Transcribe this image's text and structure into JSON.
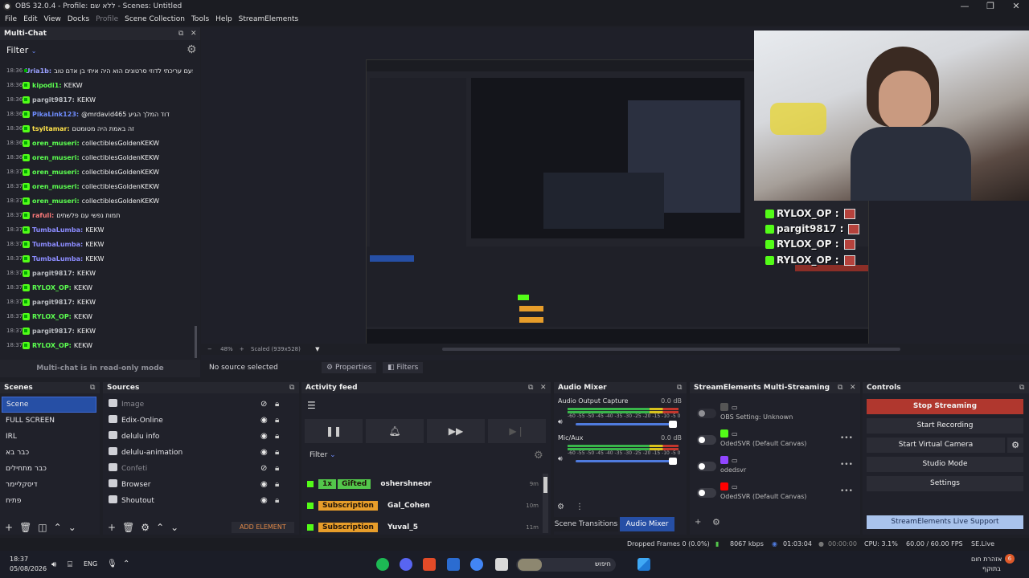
{
  "window": {
    "title": "OBS 32.0.4 - Profile: ללא שם - Scenes: Untitled",
    "min": "—",
    "max": "❐",
    "close": "✕"
  },
  "menu": [
    "File",
    "Edit",
    "View",
    "Docks",
    "Profile",
    "Scene Collection",
    "Tools",
    "Help",
    "StreamElements"
  ],
  "chat": {
    "title": "Multi-Chat",
    "filter_label": "Filter",
    "readonly_notice": "Multi-chat is in read-only mode",
    "messages": [
      {
        "time": "18:36",
        "user": "Uria1b:",
        "text": "פעם עריכתי לדוזי סרטונים הוא היה איתי בן אדם טוב",
        "color": "#9aa0ff"
      },
      {
        "time": "18:36",
        "user": "kipodi1:",
        "text": "KEKW",
        "color": "#5cff50"
      },
      {
        "time": "18:36",
        "user": "pargit9817:",
        "text": "KEKW",
        "color": "#b8bbc0"
      },
      {
        "time": "18:36",
        "user": "PikaLink123:",
        "text": "@mrdavid465 דוד המלך הגיע",
        "color": "#6f8dff"
      },
      {
        "time": "18:36",
        "user": "tsyitamar:",
        "text": "זה באמת היה מטומטם",
        "color": "#ffe24a"
      },
      {
        "time": "18:36",
        "user": "oren_museri:",
        "text": "collectiblesGoldenKEKW",
        "color": "#5cff50"
      },
      {
        "time": "18:36",
        "user": "oren_museri:",
        "text": "collectiblesGoldenKEKW",
        "color": "#5cff50"
      },
      {
        "time": "18:37",
        "user": "oren_museri:",
        "text": "collectiblesGoldenKEKW",
        "color": "#5cff50"
      },
      {
        "time": "18:37",
        "user": "oren_museri:",
        "text": "collectiblesGoldenKEKW",
        "color": "#5cff50"
      },
      {
        "time": "18:37",
        "user": "oren_museri:",
        "text": "collectiblesGoldenKEKW",
        "color": "#5cff50"
      },
      {
        "time": "18:37",
        "user": "rafuli:",
        "text": "תמות נפשי עם פלשתים",
        "color": "#ff7a7a"
      },
      {
        "time": "18:37",
        "user": "TumbaLumba:",
        "text": "KEKW",
        "color": "#8c8cff"
      },
      {
        "time": "18:37",
        "user": "TumbaLumba:",
        "text": "KEKW",
        "color": "#8c8cff"
      },
      {
        "time": "18:37",
        "user": "TumbaLumba:",
        "text": "KEKW",
        "color": "#8c8cff"
      },
      {
        "time": "18:37",
        "user": "pargit9817:",
        "text": "KEKW",
        "color": "#b8bbc0"
      },
      {
        "time": "18:37",
        "user": "RYLOX_OP:",
        "text": "KEKW",
        "color": "#5cff50"
      },
      {
        "time": "18:37",
        "user": "pargit9817:",
        "text": "KEKW",
        "color": "#b8bbc0"
      },
      {
        "time": "18:37",
        "user": "RYLOX_OP:",
        "text": "KEKW",
        "color": "#5cff50"
      },
      {
        "time": "18:37",
        "user": "pargit9817:",
        "text": "KEKW",
        "color": "#b8bbc0"
      },
      {
        "time": "18:37",
        "user": "RYLOX_OP:",
        "text": "KEKW",
        "color": "#5cff50"
      }
    ]
  },
  "overlay": [
    {
      "user": "RYLOX_OP :"
    },
    {
      "user": "pargit9817 :"
    },
    {
      "user": "RYLOX_OP :"
    },
    {
      "user": "RYLOX_OP :"
    }
  ],
  "preview": {
    "zoom": "48%",
    "scaled": "Scaled (939x528)",
    "no_source": "No source selected",
    "properties": "Properties",
    "filters": "Filters"
  },
  "scenes": {
    "title": "Scenes",
    "items": [
      "Scene",
      "FULL SCREEN",
      "IRL",
      "כבר בא",
      "כבר מתחילים",
      "דיסקליימר",
      "פתיח"
    ]
  },
  "sources": {
    "title": "Sources",
    "add_element": "ADD ELEMENT",
    "items": [
      {
        "name": "Image",
        "hidden": true
      },
      {
        "name": "Edix-Online",
        "hidden": false
      },
      {
        "name": "delulu info",
        "hidden": false
      },
      {
        "name": "delulu-animation",
        "hidden": false
      },
      {
        "name": "Confeti",
        "hidden": true
      },
      {
        "name": "Browser",
        "hidden": false
      },
      {
        "name": "Shoutout",
        "hidden": false
      }
    ]
  },
  "activity": {
    "title": "Activity feed",
    "filter_label": "Filter",
    "events": [
      {
        "tag": "Gifted",
        "count": "1x",
        "user": "oshershneor",
        "time": "9m"
      },
      {
        "tag": "Subscription",
        "user": "Gal_Cohen",
        "time": "10m"
      },
      {
        "tag": "Subscription",
        "user": "Yuval_5",
        "time": "11m"
      }
    ]
  },
  "mixer": {
    "title": "Audio Mixer",
    "channels": [
      {
        "name": "Audio Output Capture",
        "db": "0.0 dB"
      },
      {
        "name": "Mic/Aux",
        "db": "0.0 dB"
      }
    ],
    "scale": "-60 -55 -50 -45 -40 -35 -30 -25 -20 -15 -10 -5 0",
    "tab_transitions": "Scene Transitions",
    "tab_mixer": "Audio Mixer"
  },
  "se": {
    "title": "StreamElements Multi-Streaming",
    "outputs": [
      {
        "label": "OBS Setting: Unknown",
        "platform": "obs",
        "color": "#555"
      },
      {
        "label": "OdedSVR (Default Canvas)",
        "platform": "kick",
        "color": "#53fc18"
      },
      {
        "label": "odedsvr",
        "platform": "twitch",
        "color": "#9146ff"
      },
      {
        "label": "OdedSVR (Default Canvas)",
        "platform": "youtube",
        "color": "#ff0000"
      }
    ]
  },
  "controls": {
    "title": "Controls",
    "stop_streaming": "Stop Streaming",
    "start_recording": "Start Recording",
    "start_virtual_camera": "Start Virtual Camera",
    "studio_mode": "Studio Mode",
    "settings": "Settings",
    "live_support": "StreamElements Live Support"
  },
  "status": {
    "dropped": "Dropped Frames 0 (0.0%)",
    "kbps": "8067 kbps",
    "live_time": "01:03:04",
    "rec_time": "00:00:00",
    "cpu": "CPU: 3.1%",
    "fps": "60.00 / 60.00 FPS",
    "version": "SE.Live 26.2.5.549"
  },
  "taskbar": {
    "time": "18:37",
    "date": "05/08/2026",
    "lang": "ENG",
    "search": "חיפוש",
    "weather_line1": "אזהרת חום",
    "weather_line2": "בתוקף",
    "notif": "6"
  }
}
